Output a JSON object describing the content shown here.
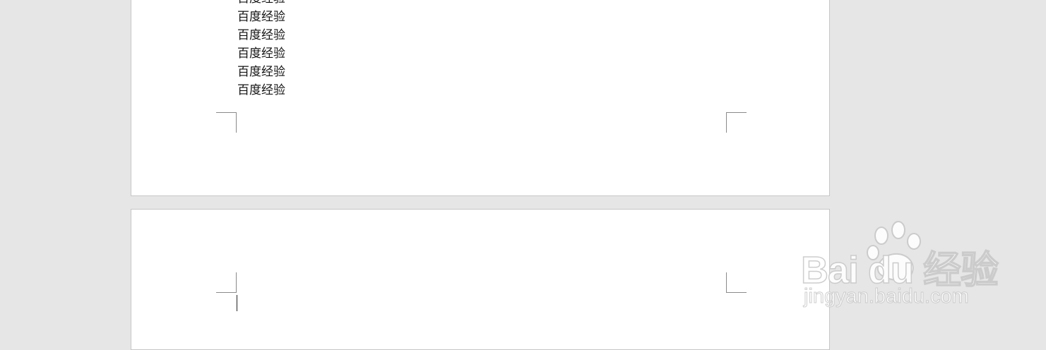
{
  "document": {
    "lines": [
      "百度经验",
      "百度经验",
      "百度经验",
      "百度经验",
      "百度经验",
      "百度经验"
    ]
  },
  "watermark": {
    "brand": "Bai  du 经验",
    "url": "jingyan.baidu.com"
  }
}
